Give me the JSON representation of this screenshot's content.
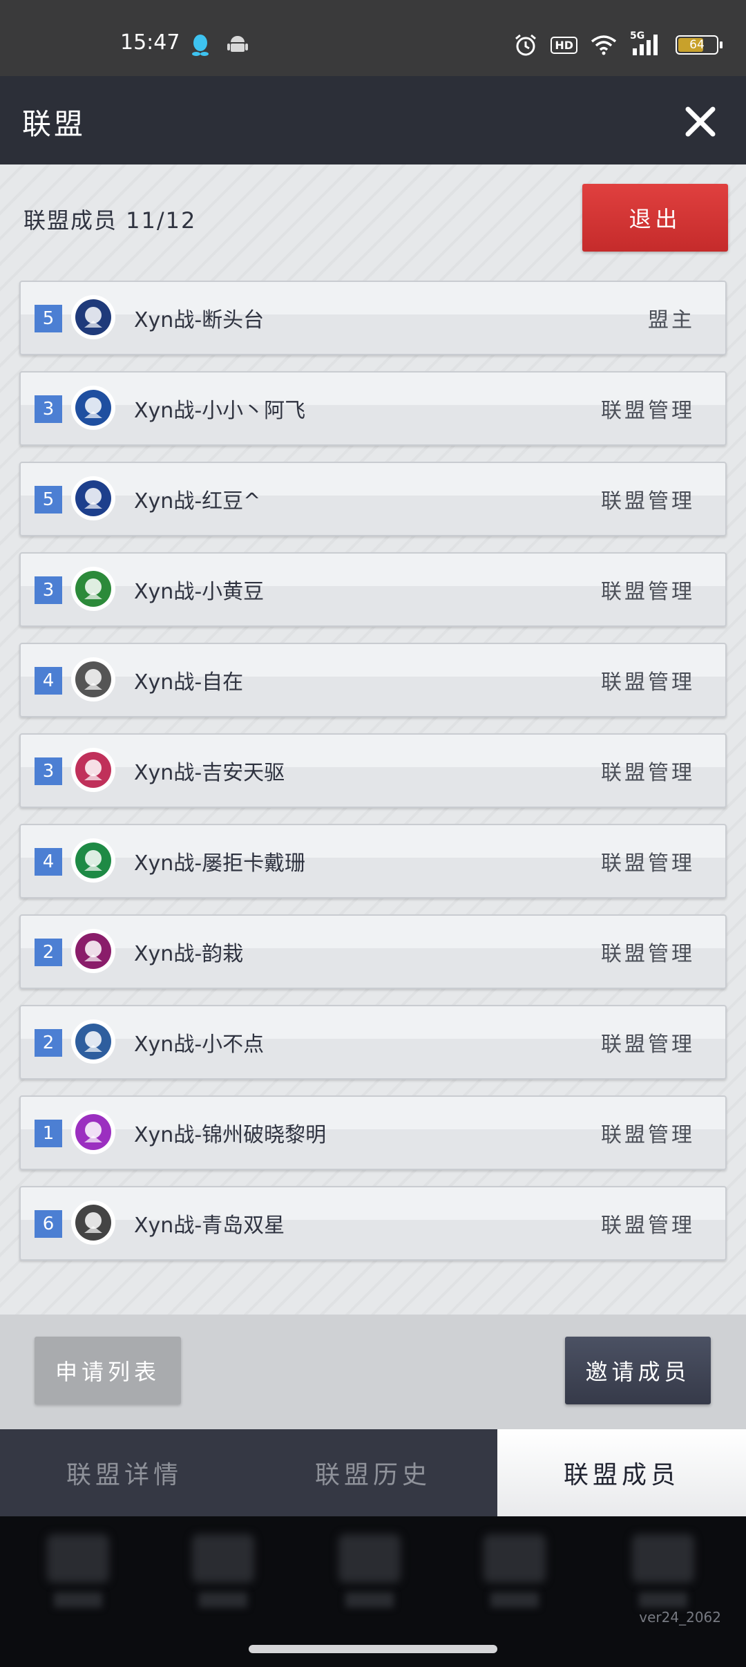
{
  "status_bar": {
    "time": "15:47",
    "hd": "HD",
    "network": "5G",
    "battery": "64",
    "icons": [
      "qq-icon",
      "android-icon",
      "alarm-icon",
      "hd-icon",
      "wifi-icon",
      "signal-5g-icon",
      "battery-icon"
    ]
  },
  "header": {
    "title": "联盟",
    "close_icon": "close-icon"
  },
  "main": {
    "member_count_label": "联盟成员 11/12",
    "quit_label": "退出"
  },
  "members": [
    {
      "rank": "5",
      "name": "Xyn战-断头台",
      "role": "盟主",
      "avatar": "eagle-badge",
      "color": "#1f3a7a"
    },
    {
      "rank": "3",
      "name": "Xyn战-小小丶阿飞",
      "role": "联盟管理",
      "avatar": "knight-badge",
      "color": "#1f4fa0"
    },
    {
      "rank": "5",
      "name": "Xyn战-红豆^",
      "role": "联盟管理",
      "avatar": "eagle-shield-badge",
      "color": "#1d3f8c"
    },
    {
      "rank": "3",
      "name": "Xyn战-小黄豆",
      "role": "联盟管理",
      "avatar": "saturn-badge",
      "color": "#2c8a3a"
    },
    {
      "rank": "4",
      "name": "Xyn战-自在",
      "role": "联盟管理",
      "avatar": "dragon-badge",
      "color": "#555555"
    },
    {
      "rank": "3",
      "name": "Xyn战-吉安天驱",
      "role": "联盟管理",
      "avatar": "flower-hex-badge",
      "color": "#c0305a"
    },
    {
      "rank": "4",
      "name": "Xyn战-屡拒卡戴珊",
      "role": "联盟管理",
      "avatar": "rhino-badge",
      "color": "#1e8a45"
    },
    {
      "rank": "2",
      "name": "Xyn战-韵栽",
      "role": "联盟管理",
      "avatar": "ninja-badge",
      "color": "#8a1d6a"
    },
    {
      "rank": "2",
      "name": "Xyn战-小不点",
      "role": "联盟管理",
      "avatar": "demon-badge",
      "color": "#2e5e9e"
    },
    {
      "rank": "1",
      "name": "Xyn战-锦州破晓黎明",
      "role": "联盟管理",
      "avatar": "pumpkin-badge",
      "color": "#9b2fc0"
    },
    {
      "rank": "6",
      "name": "Xyn战-青岛双星",
      "role": "联盟管理",
      "avatar": "wolf-shield-badge",
      "color": "#444444"
    }
  ],
  "actions": {
    "apply_list_label": "申请列表",
    "invite_label": "邀请成员"
  },
  "tabs": [
    {
      "label": "联盟详情",
      "active": false
    },
    {
      "label": "联盟历史",
      "active": false
    },
    {
      "label": "联盟成员",
      "active": true
    }
  ],
  "version": "ver24_2062"
}
